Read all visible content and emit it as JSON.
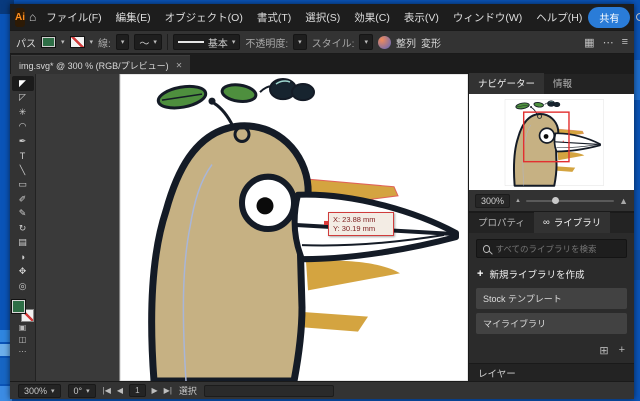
{
  "titlebar": {
    "logo": "Ai",
    "home_icon": "⌂",
    "menus": [
      "ファイル(F)",
      "編集(E)",
      "オブジェクト(O)",
      "書式(T)",
      "選択(S)",
      "効果(C)",
      "表示(V)",
      "ウィンドウ(W)",
      "ヘルプ(H)"
    ],
    "share_label": "共有",
    "window_controls": {
      "minimize": "─",
      "maximize": "□",
      "close": "✕"
    }
  },
  "controlbar": {
    "target_label": "パス",
    "stroke_label": "線:",
    "line_style_label": "基本",
    "opacity_label": "不透明度:",
    "style_label": "スタイル:",
    "align_label": "整列",
    "transform_label": "変形"
  },
  "tabbar": {
    "title": "img.svg* @ 300 % (RGB/プレビュー)",
    "close_icon": "✕"
  },
  "tools": [
    {
      "name": "selection",
      "glyph": "◤"
    },
    {
      "name": "direct-selection",
      "glyph": "◸"
    },
    {
      "name": "magic-wand",
      "glyph": "✳"
    },
    {
      "name": "lasso",
      "glyph": "◠"
    },
    {
      "name": "pen",
      "glyph": "✒"
    },
    {
      "name": "type",
      "glyph": "T"
    },
    {
      "name": "line-segment",
      "glyph": "╲"
    },
    {
      "name": "rectangle",
      "glyph": "▭"
    },
    {
      "name": "paintbrush",
      "glyph": "✐"
    },
    {
      "name": "pencil",
      "glyph": "✎"
    },
    {
      "name": "rotate",
      "glyph": "↻"
    },
    {
      "name": "gradient",
      "glyph": "▤"
    },
    {
      "name": "eyedropper",
      "glyph": "◑"
    },
    {
      "name": "hand",
      "glyph": "✥"
    },
    {
      "name": "zoom",
      "glyph": "◎"
    }
  ],
  "canvas": {
    "tooltip": {
      "x": "X: 23.88 mm",
      "y": "Y: 30.19 mm"
    }
  },
  "statusbar": {
    "zoom": "300%",
    "rotation": "0°",
    "nav_first": "|◀",
    "nav_prev": "◀",
    "artboard": "1",
    "nav_next": "▶",
    "nav_last": "▶|",
    "mode_label": "選択"
  },
  "navigator": {
    "tab_navigator": "ナビゲーター",
    "tab_info": "情報",
    "zoom": "300%"
  },
  "libraries": {
    "tab_properties": "プロパティ",
    "cc_icon": "∞",
    "tab_libraries": "ライブラリ",
    "search_placeholder": "すべてのライブラリを検索",
    "create_plus": "+",
    "create_label": "新規ライブラリを作成",
    "items": [
      "Stock テンプレート",
      "マイライブラリ"
    ],
    "footer_new_icon": "⊞",
    "footer_plus_icon": "+"
  },
  "layers": {
    "title": "レイヤー"
  },
  "colors": {
    "accent_blue": "#2a7cd8",
    "fill_green": "#2e6e46",
    "bird_tan": "#c6b183",
    "mustard": "#d4a440",
    "leaf_green": "#4e8f3e",
    "outline_navy": "#141b26",
    "tooltip_red": "#d03c3c"
  }
}
